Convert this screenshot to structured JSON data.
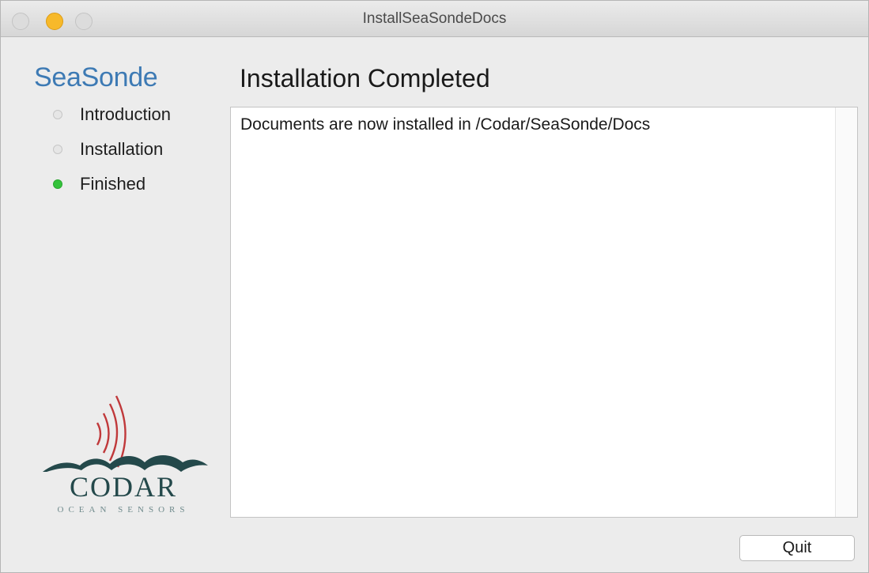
{
  "window": {
    "title": "InstallSeaSondeDocs"
  },
  "sidebar": {
    "brand": "SeaSonde",
    "steps": [
      {
        "label": "Introduction",
        "status": "done"
      },
      {
        "label": "Installation",
        "status": "done"
      },
      {
        "label": "Finished",
        "status": "current"
      }
    ],
    "logo": {
      "name": "CODAR",
      "tagline": "OCEAN SENSORS",
      "icon": "codar-logo-waves-icon"
    }
  },
  "main": {
    "title": "Installation Completed",
    "message": "Documents are now installed in /Codar/SeaSonde/Docs"
  },
  "footer": {
    "quit_label": "Quit"
  },
  "colors": {
    "brand": "#3d7ab4",
    "active_step": "#34c33b",
    "minimize": "#f7b92a",
    "logo_red": "#c0393b",
    "logo_teal": "#24494b"
  }
}
